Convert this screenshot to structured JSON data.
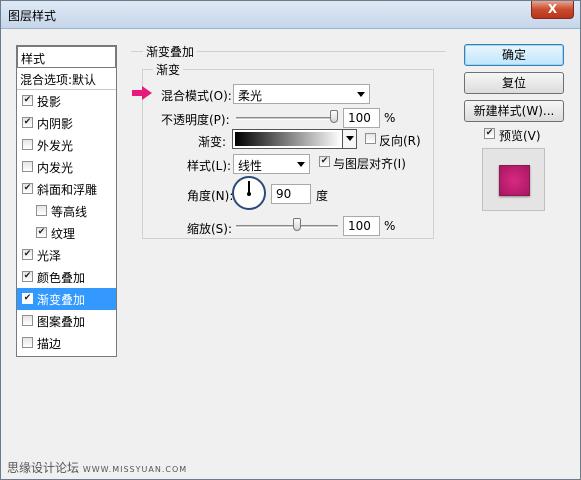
{
  "window": {
    "title": "图层样式",
    "close_label": "X"
  },
  "left_panel": {
    "header": "样式",
    "blend": "混合选项:默认",
    "items": [
      {
        "label": "投影",
        "checked": true,
        "sub": false,
        "selected": false
      },
      {
        "label": "内阴影",
        "checked": true,
        "sub": false,
        "selected": false
      },
      {
        "label": "外发光",
        "checked": false,
        "sub": false,
        "selected": false
      },
      {
        "label": "内发光",
        "checked": false,
        "sub": false,
        "selected": false
      },
      {
        "label": "斜面和浮雕",
        "checked": true,
        "sub": false,
        "selected": false
      },
      {
        "label": "等高线",
        "checked": false,
        "sub": true,
        "selected": false
      },
      {
        "label": "纹理",
        "checked": true,
        "sub": true,
        "selected": false
      },
      {
        "label": "光泽",
        "checked": true,
        "sub": false,
        "selected": false
      },
      {
        "label": "颜色叠加",
        "checked": true,
        "sub": false,
        "selected": false
      },
      {
        "label": "渐变叠加",
        "checked": true,
        "sub": false,
        "selected": true
      },
      {
        "label": "图案叠加",
        "checked": false,
        "sub": false,
        "selected": false
      },
      {
        "label": "描边",
        "checked": false,
        "sub": false,
        "selected": false
      }
    ]
  },
  "section": {
    "title": "渐变叠加",
    "group": "渐变",
    "blend_mode_label": "混合模式(O):",
    "blend_mode_value": "柔光",
    "opacity_label": "不透明度(P):",
    "opacity_value": "100",
    "opacity_unit": "%",
    "opacity_level": 1.0,
    "gradient_label": "渐变:",
    "reverse_label": "反向(R)",
    "reverse_checked": false,
    "style_label": "样式(L):",
    "style_value": "线性",
    "align_label": "与图层对齐(I)",
    "align_checked": true,
    "angle_label": "角度(N):",
    "angle_value": "90",
    "angle_unit": "度",
    "scale_label": "缩放(S):",
    "scale_value": "100",
    "scale_unit": "%",
    "scale_level": 0.6
  },
  "buttons": {
    "ok": "确定",
    "reset": "复位",
    "new_style": "新建样式(W)...",
    "preview_label": "预览(V)",
    "preview_checked": true
  },
  "watermark": {
    "cn": "思缘设计论坛",
    "url": "WWW.MISSYUAN.COM"
  },
  "colors": {
    "accent_arrow": "#e8197d",
    "selection": "#3399ff",
    "swatch": "#c41e72"
  }
}
